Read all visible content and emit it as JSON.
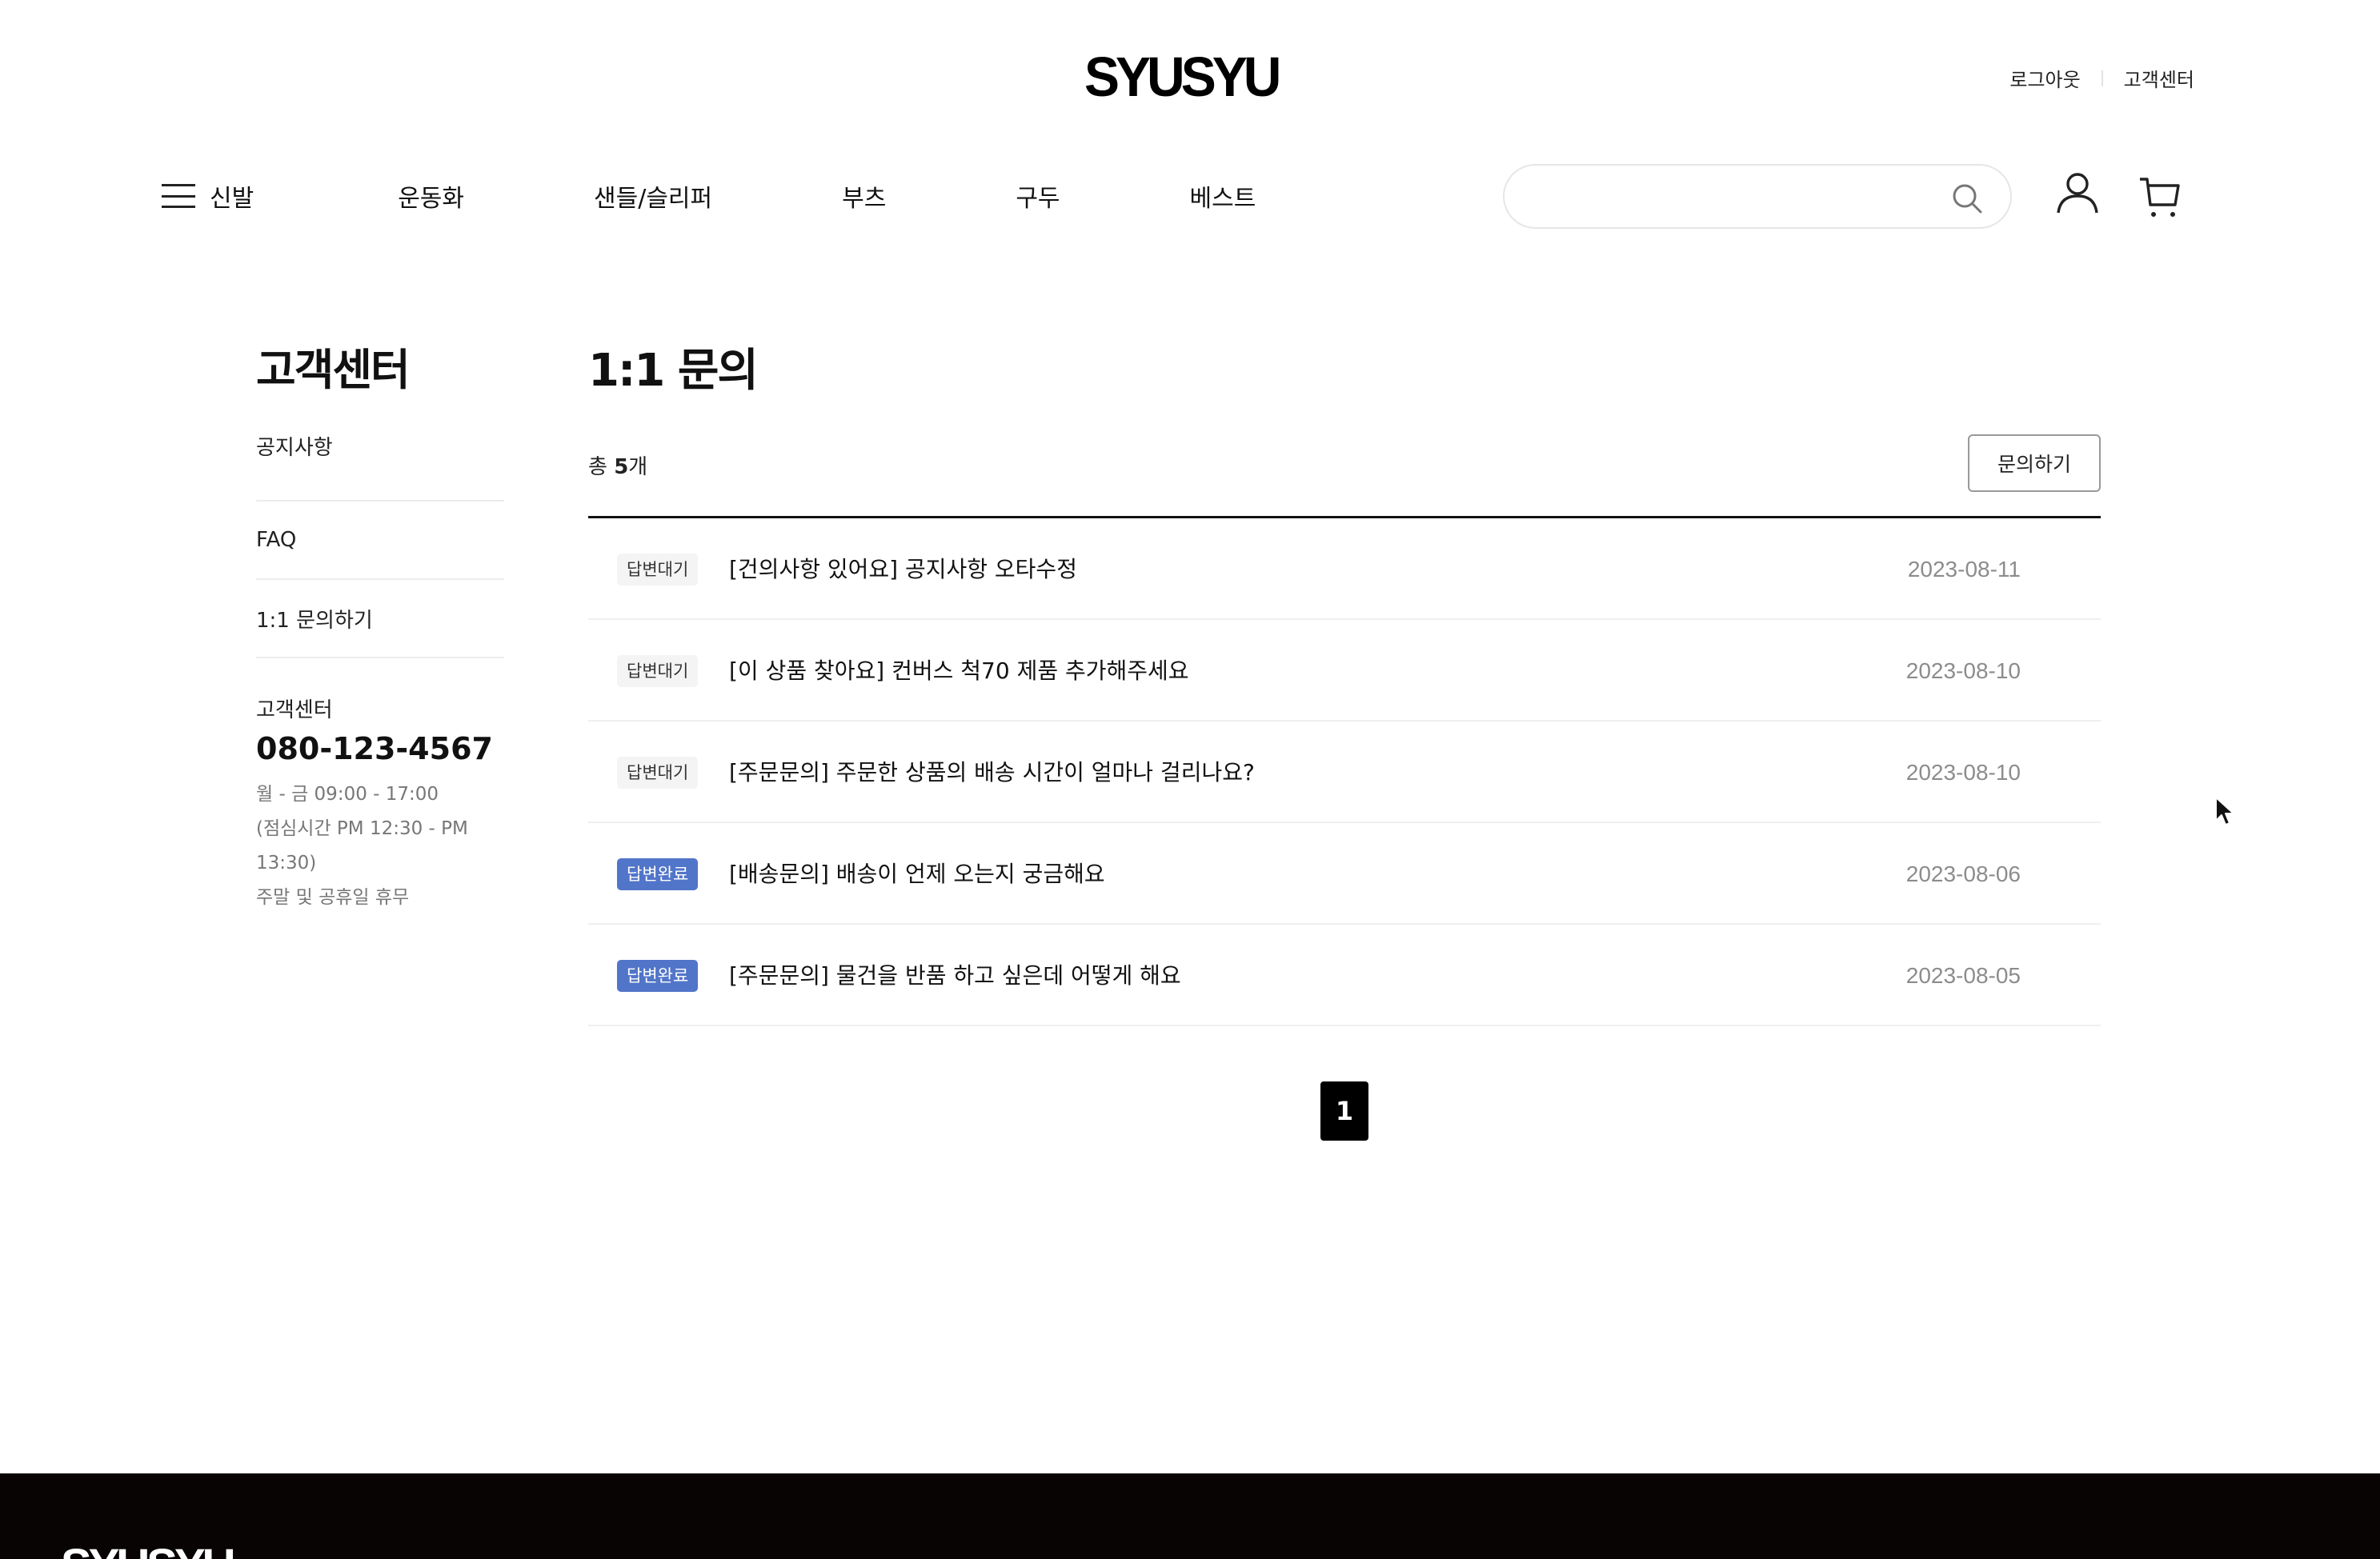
{
  "header": {
    "logo": "SYUSYU",
    "top_links": [
      "로그아웃",
      "고객센터"
    ],
    "nav": [
      "신발",
      "운동화",
      "샌들/슬리퍼",
      "부츠",
      "구두",
      "베스트"
    ],
    "search": {
      "value": "",
      "placeholder": ""
    },
    "icons": [
      "menu-icon",
      "search-icon",
      "user-icon",
      "cart-icon"
    ]
  },
  "sidebar": {
    "title": "고객센터",
    "menu": [
      "공지사항",
      "FAQ",
      "1:1 문의하기"
    ],
    "cs": {
      "title": "고객센터",
      "phone": "080-123-4567",
      "hours": [
        "월 - 금 09:00 - 17:00",
        "(점심시간 PM 12:30 - PM",
        "13:30)",
        "주말 및 공휴일 휴무"
      ]
    }
  },
  "main": {
    "title": "1:1 문의",
    "count_prefix": "총",
    "count": "5",
    "count_suffix": "개",
    "ask_button": "문의하기",
    "rows": [
      {
        "status": "답변대기",
        "status_type": "waiting",
        "title": "[건의사항 있어요] 공지사항 오타수정",
        "date": "2023-08-11"
      },
      {
        "status": "답변대기",
        "status_type": "waiting",
        "title": "[이 상품 찾아요] 컨버스 척70 제품 추가해주세요",
        "date": "2023-08-10"
      },
      {
        "status": "답변대기",
        "status_type": "waiting",
        "title": "[주문문의] 주문한 상품의 배송 시간이 얼마나 걸리나요?",
        "date": "2023-08-10"
      },
      {
        "status": "답변완료",
        "status_type": "done",
        "title": "[배송문의] 배송이 언제 오는지 궁금해요",
        "date": "2023-08-06"
      },
      {
        "status": "답변완료",
        "status_type": "done",
        "title": "[주문문의] 물건을 반품 하고 싶은데 어떻게 해요",
        "date": "2023-08-05"
      }
    ],
    "pagination": {
      "current": "1"
    }
  },
  "footer": {
    "logo": "SYUSYU"
  },
  "colors": {
    "badge_done": "#5175c9",
    "badge_waiting": "#f4f4f4",
    "footer_bg": "#080404"
  }
}
